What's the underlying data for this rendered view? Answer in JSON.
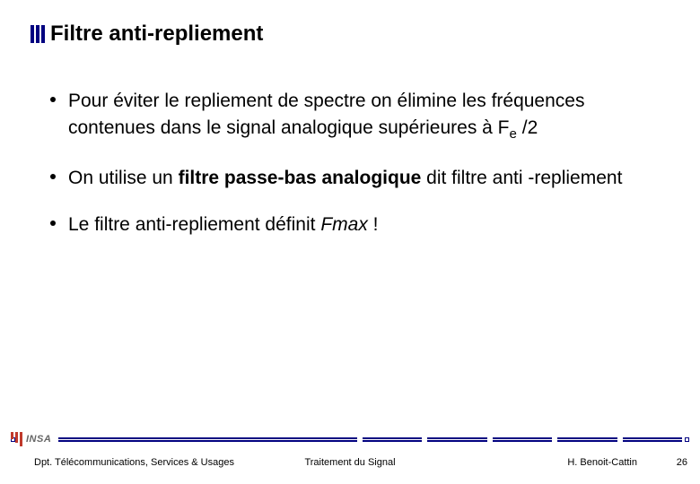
{
  "title": "Filtre anti-repliement",
  "bullets": {
    "b1_pre": "Pour éviter le repliement de spectre on élimine les fréquences contenues dans le signal analogique supérieures à F",
    "b1_sub": "e",
    "b1_post": " /2",
    "b2_pre": "On utilise un ",
    "b2_bold": "filtre passe-bas analogique",
    "b2_post": " dit filtre anti -repliement",
    "b3_pre": "Le filtre anti-repliement définit ",
    "b3_italic": "Fmax",
    "b3_post": " !"
  },
  "logo": {
    "text": "INSA"
  },
  "footer": {
    "left": "Dpt. Télécommunications, Services & Usages",
    "center": "Traitement du Signal",
    "right": "H. Benoit-Cattin",
    "page": "26"
  }
}
